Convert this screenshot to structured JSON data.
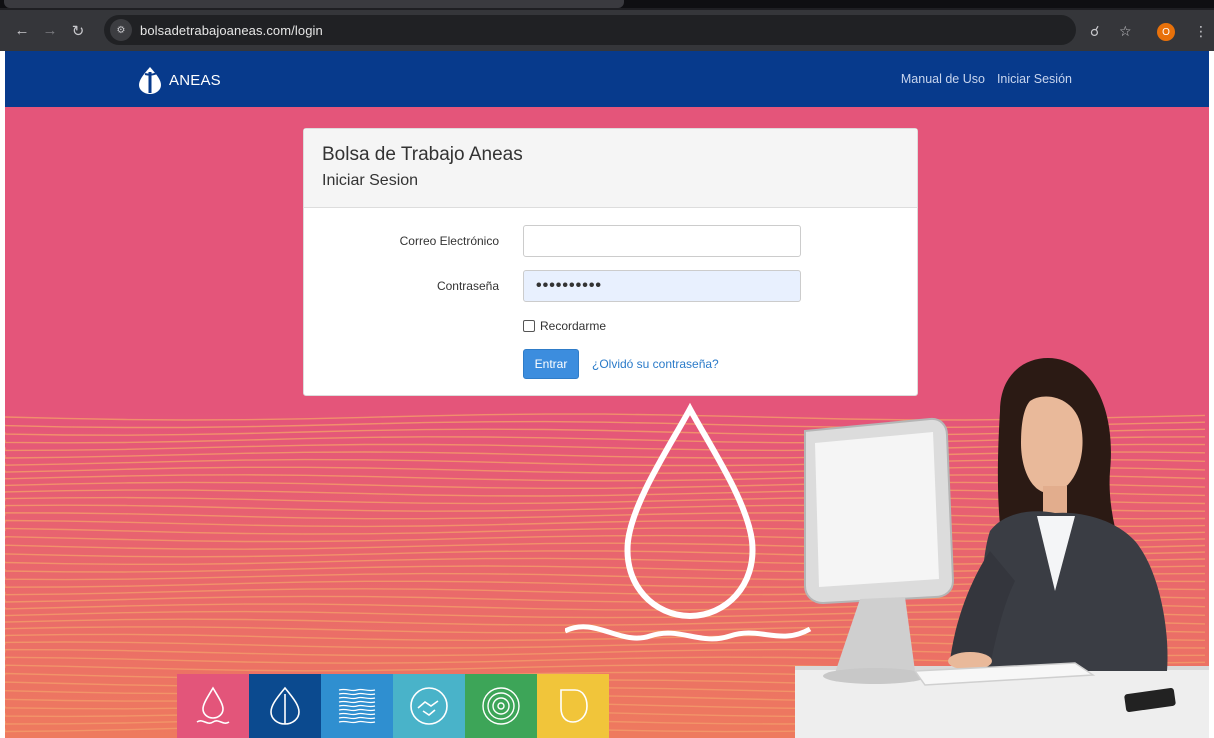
{
  "browser": {
    "url": "bolsadetrabajoaneas.com/login",
    "profile_initial": "O",
    "icons": [
      "back-icon",
      "forward-icon",
      "reload-icon",
      "site-info-icon",
      "key-icon",
      "star-icon",
      "menu-icon"
    ]
  },
  "navbar": {
    "brand": "ANEAS",
    "links": [
      "Manual de Uso",
      "Iniciar Sesión"
    ]
  },
  "login": {
    "title": "Bolsa de Trabajo Aneas",
    "subtitle": "Iniciar Sesion",
    "email_label": "Correo Electrónico",
    "email_value": "",
    "password_label": "Contraseña",
    "password_value": "••••••••••",
    "remember_label": "Recordarme",
    "remember_checked": false,
    "submit_label": "Entrar",
    "forgot_label": "¿Olvidó su contraseña?"
  },
  "colors": {
    "navbar": "#073a8c",
    "background": "#e4557a",
    "primary_button": "#3c8dde",
    "tiles": [
      "#e3557a",
      "#0b4a8f",
      "#2f8fd0",
      "#49b3c9",
      "#3da558",
      "#f1c53a"
    ]
  },
  "tile_icons": [
    "water-drop-icon",
    "leaf-drop-icon",
    "waves-icon",
    "handshake-icon",
    "target-rings-icon",
    "drop-outline-icon"
  ]
}
